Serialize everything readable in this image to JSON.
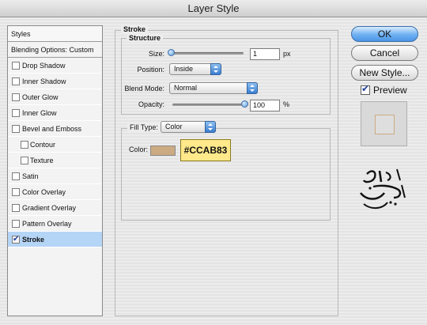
{
  "window": {
    "title": "Layer Style"
  },
  "styles_panel": {
    "header": "Styles",
    "blending_options": "Blending Options: Custom",
    "items": [
      {
        "label": "Drop Shadow",
        "checked": false,
        "sub": false
      },
      {
        "label": "Inner Shadow",
        "checked": false,
        "sub": false
      },
      {
        "label": "Outer Glow",
        "checked": false,
        "sub": false
      },
      {
        "label": "Inner Glow",
        "checked": false,
        "sub": false
      },
      {
        "label": "Bevel and Emboss",
        "checked": false,
        "sub": false
      },
      {
        "label": "Contour",
        "checked": false,
        "sub": true
      },
      {
        "label": "Texture",
        "checked": false,
        "sub": true
      },
      {
        "label": "Satin",
        "checked": false,
        "sub": false
      },
      {
        "label": "Color Overlay",
        "checked": false,
        "sub": false
      },
      {
        "label": "Gradient Overlay",
        "checked": false,
        "sub": false
      },
      {
        "label": "Pattern Overlay",
        "checked": false,
        "sub": false
      },
      {
        "label": "Stroke",
        "checked": true,
        "sub": false,
        "selected": true
      }
    ]
  },
  "stroke": {
    "title": "Stroke",
    "structure": {
      "title": "Structure",
      "size_label": "Size:",
      "size_value": "1",
      "size_unit": "px",
      "position_label": "Position:",
      "position_value": "Inside",
      "blend_mode_label": "Blend Mode:",
      "blend_mode_value": "Normal",
      "opacity_label": "Opacity:",
      "opacity_value": "100",
      "opacity_unit": "%"
    },
    "fill": {
      "fill_type_label": "Fill Type:",
      "fill_type_value": "Color",
      "color_label": "Color:",
      "color_hex_label": "#CCAB83",
      "color": "#ccab83"
    }
  },
  "buttons": {
    "ok": "OK",
    "cancel": "Cancel",
    "new_style": "New Style...",
    "preview_label": "Preview"
  },
  "logo": {
    "icon": "calligraphy-logo"
  }
}
